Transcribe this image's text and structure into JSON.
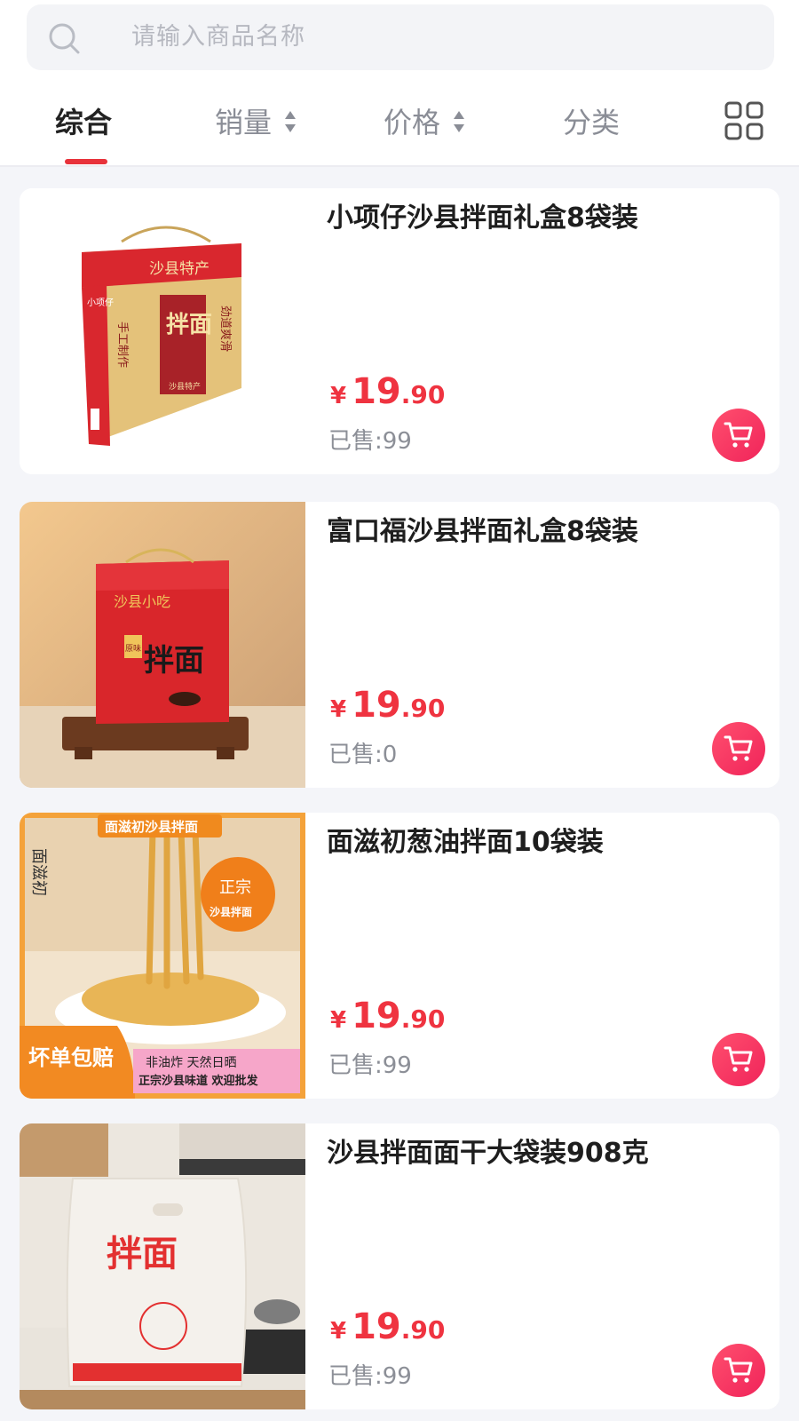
{
  "search": {
    "placeholder": "请输入商品名称"
  },
  "tabs": [
    {
      "label": "综合",
      "active": true
    },
    {
      "label": "销量",
      "sortable": true
    },
    {
      "label": "价格",
      "sortable": true
    },
    {
      "label": "分类"
    }
  ],
  "colors": {
    "accent": "#e8323a",
    "price": "#ef3340",
    "cart": "#f0245a",
    "background": "#f4f5f9"
  },
  "products": [
    {
      "title": "小项仔沙县拌面礼盒8袋装",
      "price_currency": "¥",
      "price_int": "19",
      "price_dec": ".90",
      "sold": "已售:99",
      "image_text": {
        "top": "沙县特产",
        "main": "拌面",
        "left": "手工制作",
        "right": "劲道爽滑",
        "brand": "小项仔",
        "bottom": "沙县特产"
      }
    },
    {
      "title": "富口福沙县拌面礼盒8袋装",
      "price_currency": "¥",
      "price_int": "19",
      "price_dec": ".90",
      "sold": "已售:0",
      "image_text": {
        "top": "沙县小吃",
        "main": "拌面",
        "badge": "原味"
      }
    },
    {
      "title": "面滋初葱油拌面10袋装",
      "price_currency": "¥",
      "price_int": "19",
      "price_dec": ".90",
      "sold": "已售:99",
      "image_text": {
        "brand": "面滋初",
        "banner": "面滋初沙县拌面",
        "circle_top": "正宗",
        "circle_bottom": "沙县拌面",
        "corner": "坏单包赔",
        "bottom_top": "非油炸 天然日晒",
        "bottom_line": "正宗沙县味道 欢迎批发"
      }
    },
    {
      "title": "沙县拌面面干大袋装908克",
      "price_currency": "¥",
      "price_int": "19",
      "price_dec": ".90",
      "sold": "已售:99",
      "image_text": {
        "main": "拌面"
      }
    }
  ]
}
